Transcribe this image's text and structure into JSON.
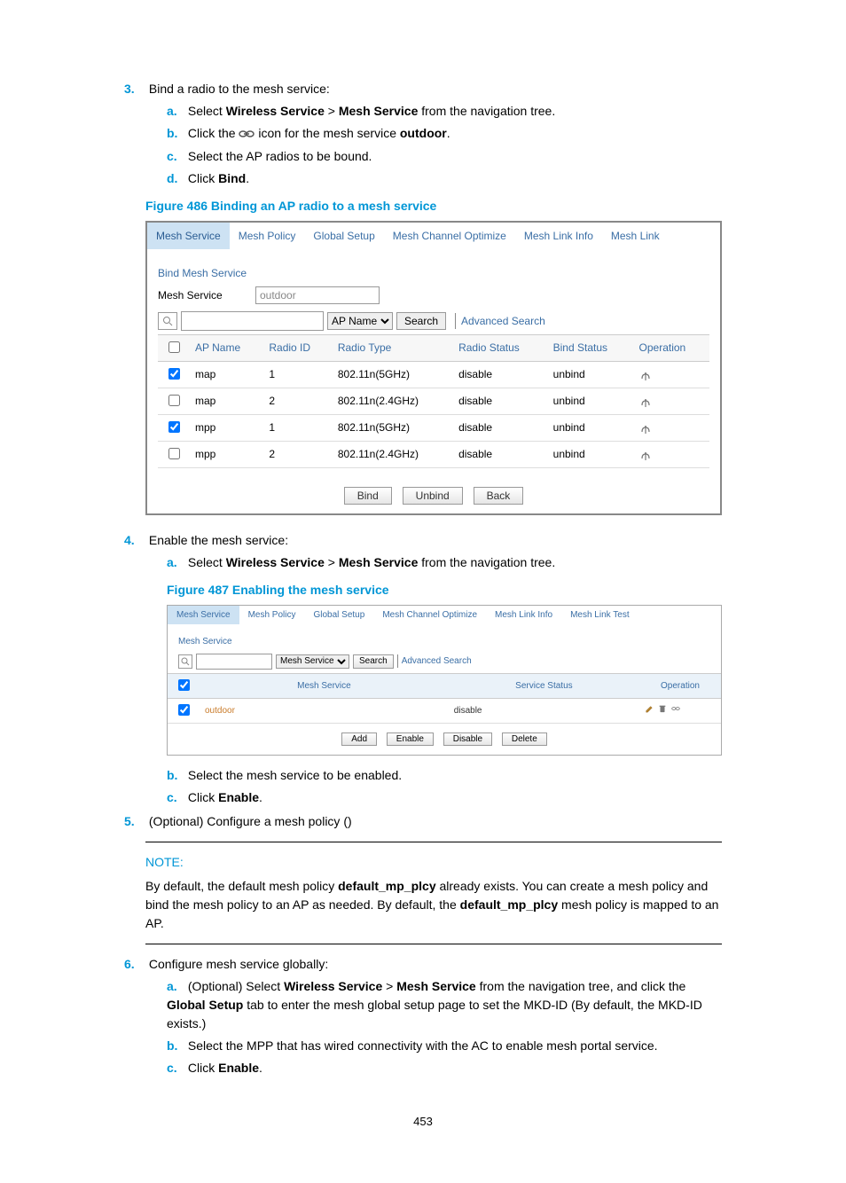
{
  "step3": {
    "num": "3.",
    "title": "Bind a radio to the mesh service:",
    "a_letter": "a.",
    "a_text": "Select ",
    "a_b1": "Wireless Service",
    "a_sep": " > ",
    "a_b2": "Mesh Service",
    "a_end": " from the navigation tree.",
    "b_letter": "b.",
    "b_text": "Click the ",
    "b_icon_name": "link-icon",
    "b_mid": " icon for the mesh service ",
    "b_bold": "outdoor",
    "b_end": ".",
    "c_letter": "c.",
    "c_text": "Select the AP radios to be bound.",
    "d_letter": "d.",
    "d_text": "Click ",
    "d_bold": "Bind",
    "d_end": "."
  },
  "fig486": {
    "caption": "Figure 486 Binding an AP radio to a mesh service",
    "tabs": [
      "Mesh Service",
      "Mesh Policy",
      "Global Setup",
      "Mesh Channel Optimize",
      "Mesh Link Info",
      "Mesh Link"
    ],
    "section": "Bind Mesh Service",
    "mesh_service_label": "Mesh Service",
    "mesh_service_value": "outdoor",
    "search_dropdown": "AP Name",
    "search_btn": "Search",
    "adv_search": "Advanced Search",
    "columns": [
      "",
      "AP Name",
      "Radio ID",
      "Radio Type",
      "Radio Status",
      "Bind Status",
      "Operation"
    ],
    "rows": [
      {
        "checked": true,
        "ap": "map",
        "id": "1",
        "type": "802.11n(5GHz)",
        "status": "disable",
        "bind": "unbind"
      },
      {
        "checked": false,
        "ap": "map",
        "id": "2",
        "type": "802.11n(2.4GHz)",
        "status": "disable",
        "bind": "unbind"
      },
      {
        "checked": true,
        "ap": "mpp",
        "id": "1",
        "type": "802.11n(5GHz)",
        "status": "disable",
        "bind": "unbind"
      },
      {
        "checked": false,
        "ap": "mpp",
        "id": "2",
        "type": "802.11n(2.4GHz)",
        "status": "disable",
        "bind": "unbind"
      }
    ],
    "bind_btn": "Bind",
    "unbind_btn": "Unbind",
    "back_btn": "Back"
  },
  "step4": {
    "num": "4.",
    "title": "Enable the mesh service:",
    "a_letter": "a.",
    "a_text": "Select ",
    "a_b1": "Wireless Service",
    "a_sep": " > ",
    "a_b2": "Mesh Service",
    "a_end": " from the navigation tree."
  },
  "fig487": {
    "caption": "Figure 487 Enabling the mesh service",
    "tabs": [
      "Mesh Service",
      "Mesh Policy",
      "Global Setup",
      "Mesh Channel Optimize",
      "Mesh Link Info",
      "Mesh Link Test"
    ],
    "section": "Mesh Service",
    "search_dropdown": "Mesh Service",
    "search_btn": "Search",
    "adv_search": "Advanced Search",
    "columns": [
      "",
      "Mesh Service",
      "Service Status",
      "Operation"
    ],
    "row": {
      "checked": true,
      "name": "outdoor",
      "status": "disable"
    },
    "add_btn": "Add",
    "enable_btn": "Enable",
    "disable_btn": "Disable",
    "delete_btn": "Delete"
  },
  "step4b": {
    "letter": "b.",
    "text": "Select the mesh service to be enabled."
  },
  "step4c": {
    "letter": "c.",
    "pre": "Click ",
    "bold": "Enable",
    "end": "."
  },
  "step5": {
    "num": "5.",
    "text": "(Optional) Configure a mesh policy ()"
  },
  "note": {
    "title": "NOTE:",
    "p1a": "By default, the default mesh policy ",
    "p1b": "default_mp_plcy",
    "p1c": " already exists. You can create a mesh policy and bind the mesh policy to an AP as needed. By default, the ",
    "p1d": "default_mp_plcy",
    "p1e": " mesh policy is mapped to an AP."
  },
  "step6": {
    "num": "6.",
    "title": "Configure mesh service globally:",
    "a_letter": "a.",
    "a_pre": "(Optional) Select ",
    "a_b1": "Wireless Service",
    "a_sep": " > ",
    "a_b2": "Mesh Service",
    "a_mid": " from the navigation tree, and click the ",
    "a_b3": "Global Setup",
    "a_end": " tab to enter the mesh global setup page to set the MKD-ID (By default, the MKD-ID exists.)",
    "b_letter": "b.",
    "b_text": "Select the MPP that has wired connectivity with the AC to enable mesh portal service.",
    "c_letter": "c.",
    "c_pre": "Click ",
    "c_bold": "Enable",
    "c_end": "."
  },
  "page_number": "453"
}
